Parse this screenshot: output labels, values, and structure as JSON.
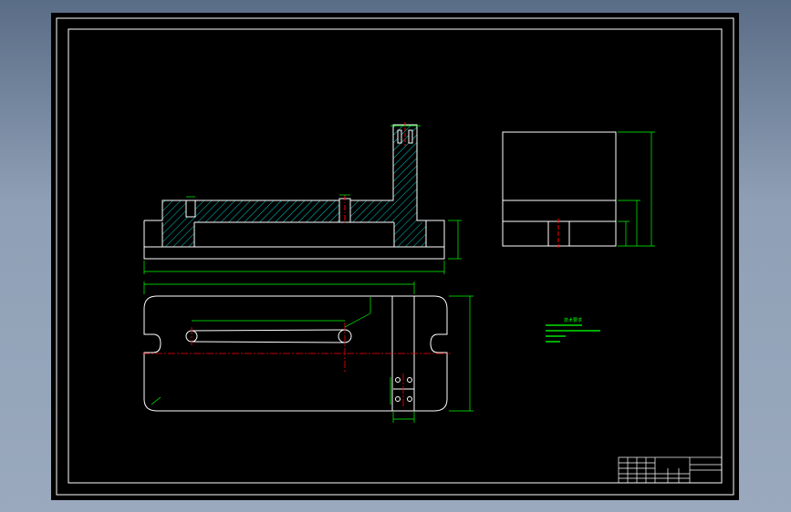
{
  "canvas": {
    "background": "#000000",
    "frame_color": "#ffffff",
    "line_color": "#ffffff",
    "dimension_color": "#00ff00",
    "hatch_color": "#00ffff",
    "centerline_color": "#ff0000"
  },
  "technical_requirements": {
    "title": "技术要求",
    "lines": [
      "",
      "",
      "",
      ""
    ]
  },
  "title_block": {
    "cells": []
  }
}
